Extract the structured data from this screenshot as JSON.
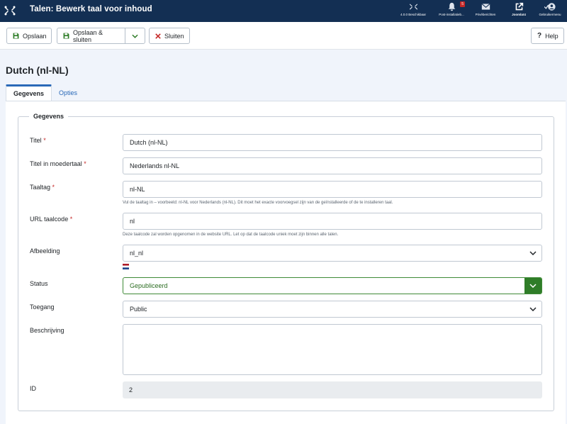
{
  "header": {
    "title": "Talen: Bewerk taal voor inhoud",
    "items": [
      {
        "label": "4.0.0 Beschikbaar",
        "icon": "joomla-icon"
      },
      {
        "label": "Post-installatieb...",
        "icon": "bell-icon",
        "badge": "5"
      },
      {
        "label": "Privéberichten",
        "icon": "envelope-icon"
      },
      {
        "label": "Joomla!4",
        "icon": "external-link-icon"
      },
      {
        "label": "Gebruikermenu",
        "icon": "user-icon"
      }
    ]
  },
  "toolbar": {
    "save_label": "Opslaan",
    "save_close_label": "Opslaan & sluiten",
    "close_label": "Sluiten",
    "help_label": "Help"
  },
  "page": {
    "title": "Dutch (nl-NL)",
    "tabs": [
      {
        "label": "Gegevens",
        "active": true
      },
      {
        "label": "Opties",
        "active": false
      }
    ],
    "legend": "Gegevens"
  },
  "form": {
    "title": {
      "label": "Titel",
      "required": "*",
      "value": "Dutch (nl-NL)"
    },
    "title_native": {
      "label": "Titel in moedertaal",
      "required": "*",
      "value": "Nederlands nl-NL"
    },
    "lang_tag": {
      "label": "Taaltag",
      "required": "*",
      "value": "nl-NL",
      "help": "Vul de taaltag in – voorbeeld: nl-NL voor Nederlands (nl-NL). Dit moet het exacte voorvoegsel zijn van de geïnstalleerde of de te installeren taal."
    },
    "sef": {
      "label": "URL taalcode",
      "required": "*",
      "value": "nl",
      "help": "Deze taalcode zal worden opgenomen in de website URL. Let op dat de taalcode uniek moet zijn binnen alle talen."
    },
    "image": {
      "label": "Afbeelding",
      "value": "nl_nl"
    },
    "status": {
      "label": "Status",
      "value": "Gepubliceerd"
    },
    "access": {
      "label": "Toegang",
      "value": "Public"
    },
    "description": {
      "label": "Beschrijving",
      "value": ""
    },
    "id": {
      "label": "ID",
      "value": "2"
    }
  },
  "colors": {
    "header_bg": "#132f53",
    "accent": "#2a69b8",
    "status_green": "#2f7d28",
    "required_red": "#c52827"
  }
}
